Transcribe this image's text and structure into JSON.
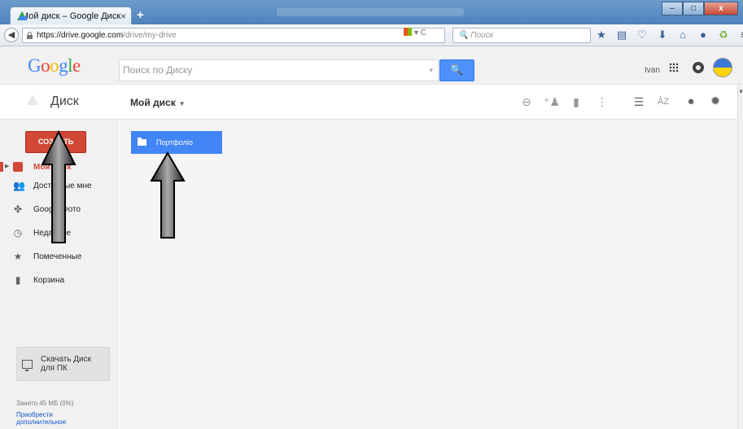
{
  "browser": {
    "tab_title": "Мой диск – Google Диск",
    "tab_close": "×",
    "new_tab": "+",
    "url_host": "https://drive.google.com",
    "url_path": "/drive/my-drive",
    "url_icons": "▾ C",
    "search_placeholder": "Поиск",
    "window_buttons": [
      "–",
      "□",
      "x"
    ],
    "toolbar_icons": [
      "star-icon",
      "reading-list-icon",
      "pocket-icon",
      "download-icon",
      "home-icon",
      "chat-icon",
      "sync-icon",
      "menu-icon"
    ]
  },
  "header": {
    "logo_letters": [
      "G",
      "o",
      "o",
      "g",
      "l",
      "e"
    ],
    "search_placeholder": "Поиск по Диску",
    "search_dropdown": "▾",
    "search_button": "🔍",
    "user_name": "Ivan"
  },
  "toolbar": {
    "app_title": "Диск",
    "location": "Мой диск",
    "location_caret": "▼"
  },
  "sidebar": {
    "create_label": "СОЗДАТЬ",
    "items": [
      {
        "label": "Мой диск",
        "icon": "drive-icon"
      },
      {
        "label": "Доступные мне",
        "icon": "shared-icon"
      },
      {
        "label": "Google Фото",
        "icon": "photos-icon"
      },
      {
        "label": "Недавние",
        "icon": "clock-icon"
      },
      {
        "label": "Помеченные",
        "icon": "star-icon"
      },
      {
        "label": "Корзина",
        "icon": "trash-icon"
      }
    ],
    "download_label": "Скачать Диск\nдля ПК",
    "storage_used": "Занято 45 МБ (0%)",
    "buy_more_line1": "Приобрести",
    "buy_more_line2": "дополнительное"
  },
  "content": {
    "folders": [
      {
        "name": "Портфоліо"
      }
    ]
  },
  "colors": {
    "accent_red": "#d14836",
    "accent_blue": "#4285f4",
    "search_blue": "#4d90fe"
  }
}
